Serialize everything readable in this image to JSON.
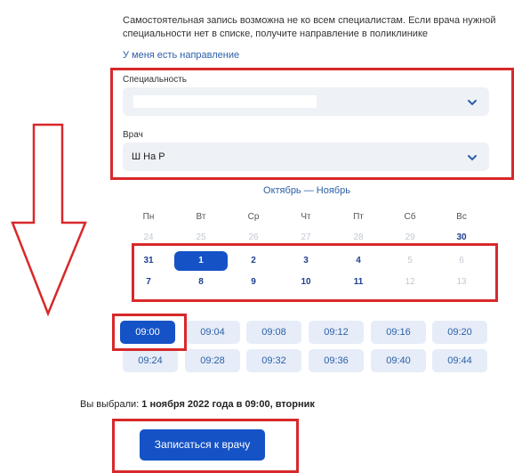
{
  "info": {
    "notice": "Самостоятельная запись возможна не ко всем специалистам. Если врача нужной специальности нет в списке, получите направление в поликлинике",
    "referral_link": "У меня есть направление"
  },
  "form": {
    "specialty_label": "Специальность",
    "specialty_value": "",
    "doctor_label": "Врач",
    "doctor_value": "Ш         На         Р"
  },
  "calendar": {
    "month_range": "Октябрь — Ноябрь",
    "weekdays": [
      "Пн",
      "Вт",
      "Ср",
      "Чт",
      "Пт",
      "Сб",
      "Вс"
    ],
    "rows": [
      [
        "24",
        "25",
        "26",
        "27",
        "28",
        "29",
        "30"
      ],
      [
        "31",
        "1",
        "2",
        "3",
        "4",
        "5",
        "6"
      ],
      [
        "7",
        "8",
        "9",
        "10",
        "11",
        "12",
        "13"
      ]
    ],
    "selected": "1"
  },
  "times": [
    "09:00",
    "09:04",
    "09:08",
    "09:12",
    "09:16",
    "09:20",
    "09:24",
    "09:28",
    "09:32",
    "09:36",
    "09:40",
    "09:44"
  ],
  "selected_time": "09:00",
  "summary": {
    "prefix": "Вы выбрали:",
    "value": "1 ноября 2022 года в 09:00, вторник"
  },
  "submit_label": "Записаться к врачу",
  "colors": {
    "accent": "#1552c6",
    "highlight": "#d8282a",
    "arrow": "#d8282a"
  }
}
